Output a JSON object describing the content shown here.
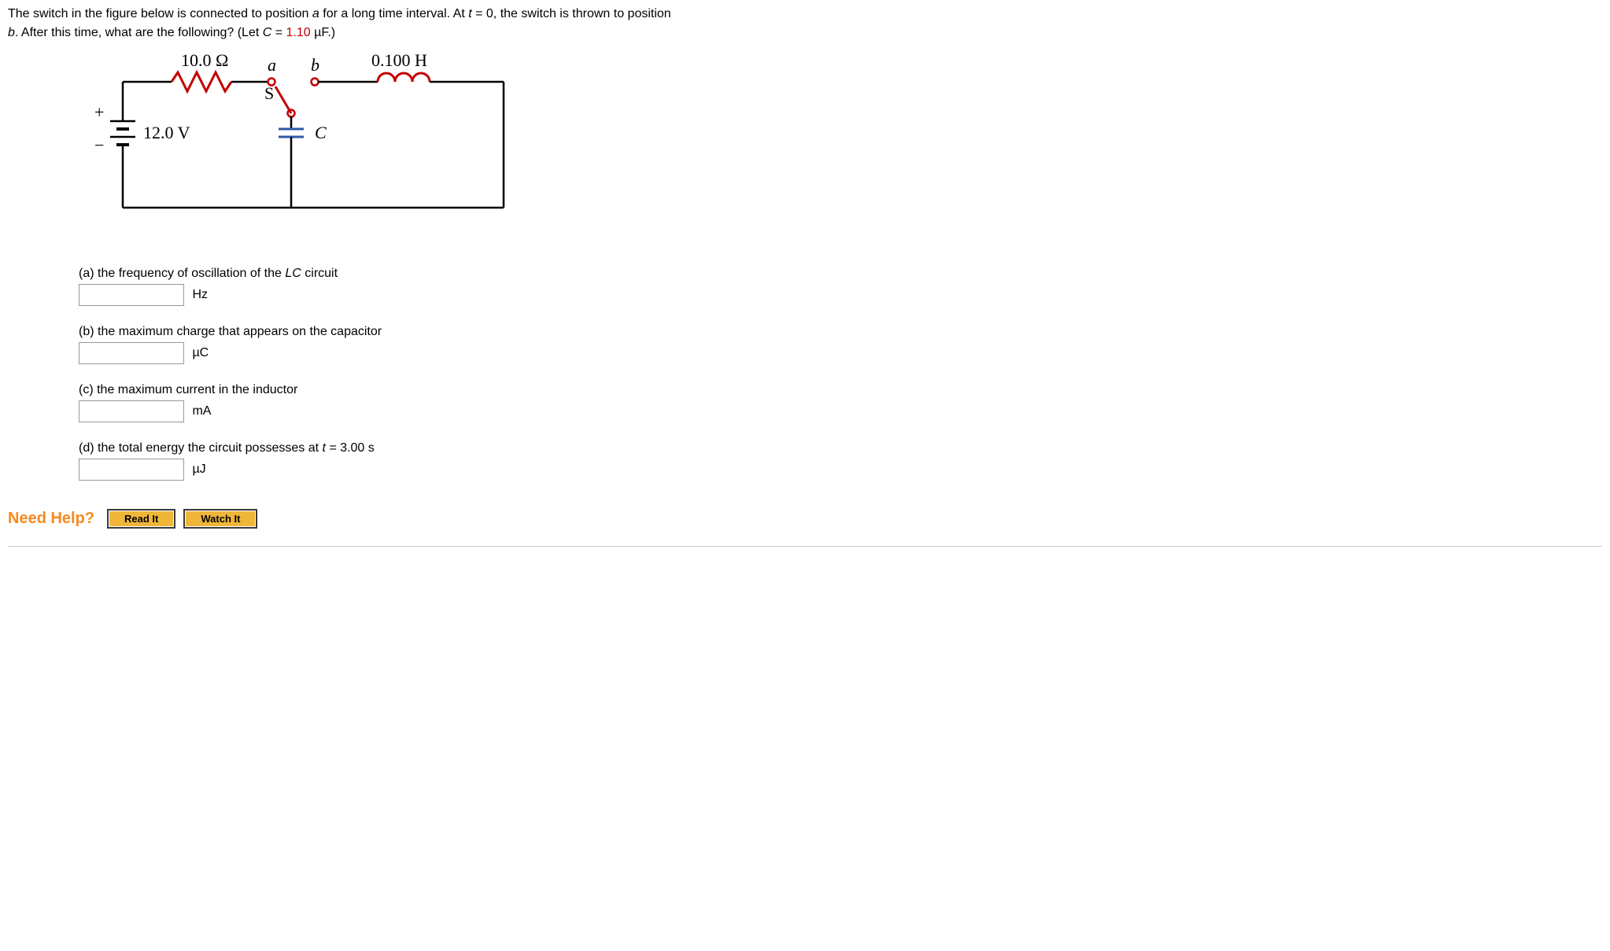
{
  "problem": {
    "line1_pre": "The switch in the figure below is connected to position ",
    "pos_a": "a",
    "line1_mid": " for a long time interval. At ",
    "t_var": "t",
    "eq_zero": " = 0, the switch is thrown to position",
    "line2_pre": "",
    "pos_b": "b",
    "line2_mid": ". After this time, what are the following? (Let ",
    "c_var": "C",
    "let_eq": " = ",
    "c_value": "1.10",
    "c_unit": " µF.)"
  },
  "circuit": {
    "resistor_label": "10.0 Ω",
    "inductor_label": "0.100 H",
    "voltage_label": "12.0 V",
    "switch_letter": "S",
    "term_a": "a",
    "term_b": "b",
    "cap_letter": "C",
    "plus": "+",
    "minus": "−"
  },
  "questions": {
    "a": {
      "text": "(a) the frequency of oscillation of the ",
      "lc": "LC",
      "text2": " circuit",
      "unit": "Hz"
    },
    "b": {
      "text": "(b) the maximum charge that appears on the capacitor",
      "unit": "µC"
    },
    "c": {
      "text": "(c) the maximum current in the inductor",
      "unit": "mA"
    },
    "d": {
      "text_pre": "(d) the total energy the circuit possesses at ",
      "t_var": "t",
      "eq": " = 3.00 s",
      "unit": "µJ"
    }
  },
  "help": {
    "label": "Need Help?",
    "read": "Read It",
    "watch": "Watch It"
  }
}
